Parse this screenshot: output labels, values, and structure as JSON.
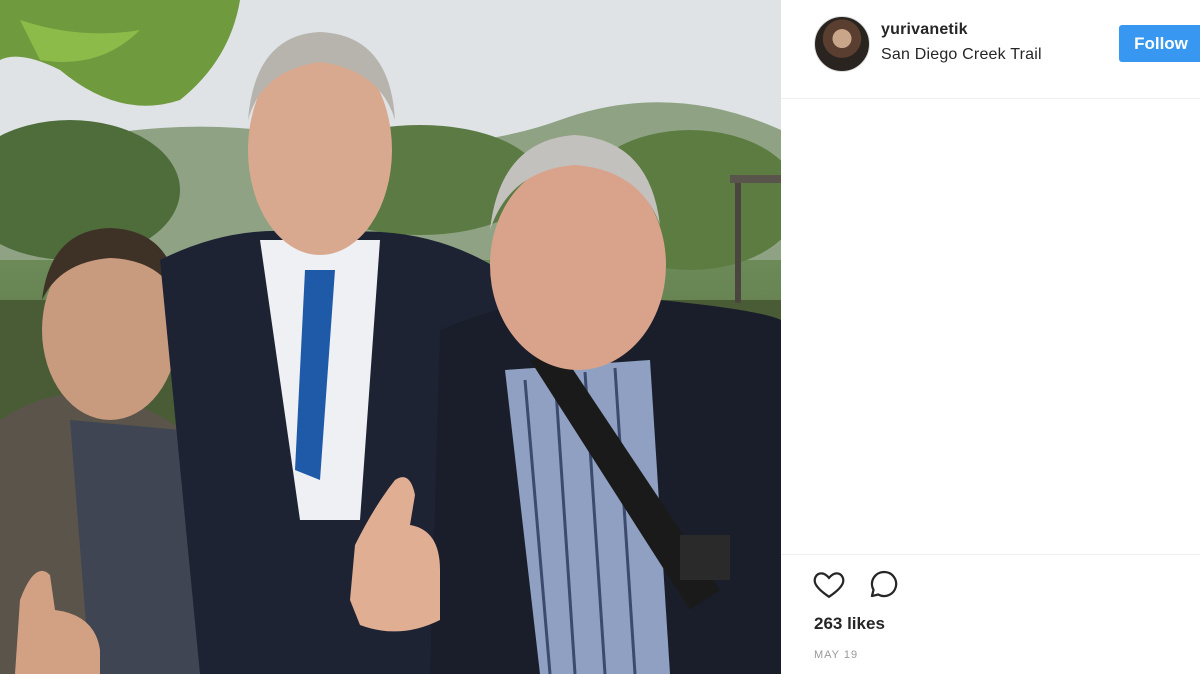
{
  "post": {
    "username": "yurivanetik",
    "location": "San Diego Creek Trail",
    "follow_label": "Follow",
    "likes": "263 likes",
    "date": "MAY 19"
  },
  "icons": {
    "like": "heart-icon",
    "comment": "comment-icon"
  },
  "colors": {
    "follow_button": "#3897f0",
    "text": "#262626",
    "muted": "#999999",
    "divider": "#efefef"
  }
}
